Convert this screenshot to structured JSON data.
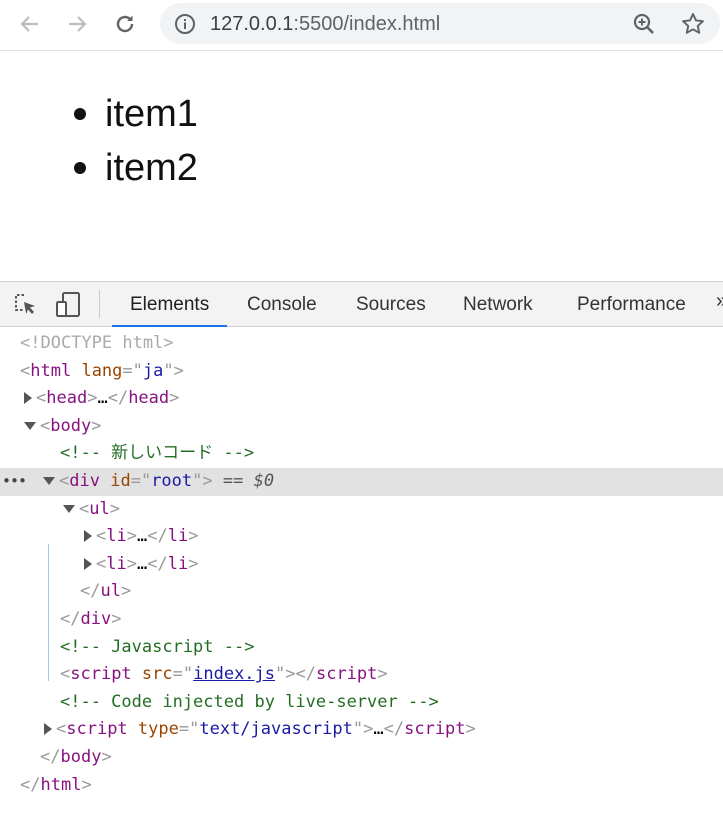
{
  "browser": {
    "url_host": "127.0.0.1",
    "url_rest": ":5500/index.html",
    "icons": [
      "back-arrow-icon",
      "forward-arrow-icon",
      "reload-icon",
      "info-icon",
      "zoom-icon",
      "star-icon"
    ]
  },
  "page": {
    "items": [
      "item1",
      "item2"
    ]
  },
  "devtools": {
    "tabs": [
      "Elements",
      "Console",
      "Sources",
      "Network",
      "Performance"
    ],
    "active_tab": "Elements",
    "more": "»",
    "dom": {
      "doctype": "<!DOCTYPE html>",
      "html_open_tag": "html",
      "html_attr_name": "lang",
      "html_attr_value": "ja",
      "head_tag": "head",
      "ellipsis": "…",
      "body_tag": "body",
      "comment1": "<!-- 新しいコード -->",
      "div_tag": "div",
      "div_attr_name": "id",
      "div_attr_value": "root",
      "selected_marker": "== $0",
      "row_dots": "•••",
      "ul_tag": "ul",
      "li_tag": "li",
      "comment2": "<!-- Javascript -->",
      "script_tag": "script",
      "script_attr_name": "src",
      "script_attr_value": "index.js",
      "comment3": "<!-- Code injected by live-server -->",
      "script2_attr_name": "type",
      "script2_attr_value": "text/javascript"
    }
  }
}
